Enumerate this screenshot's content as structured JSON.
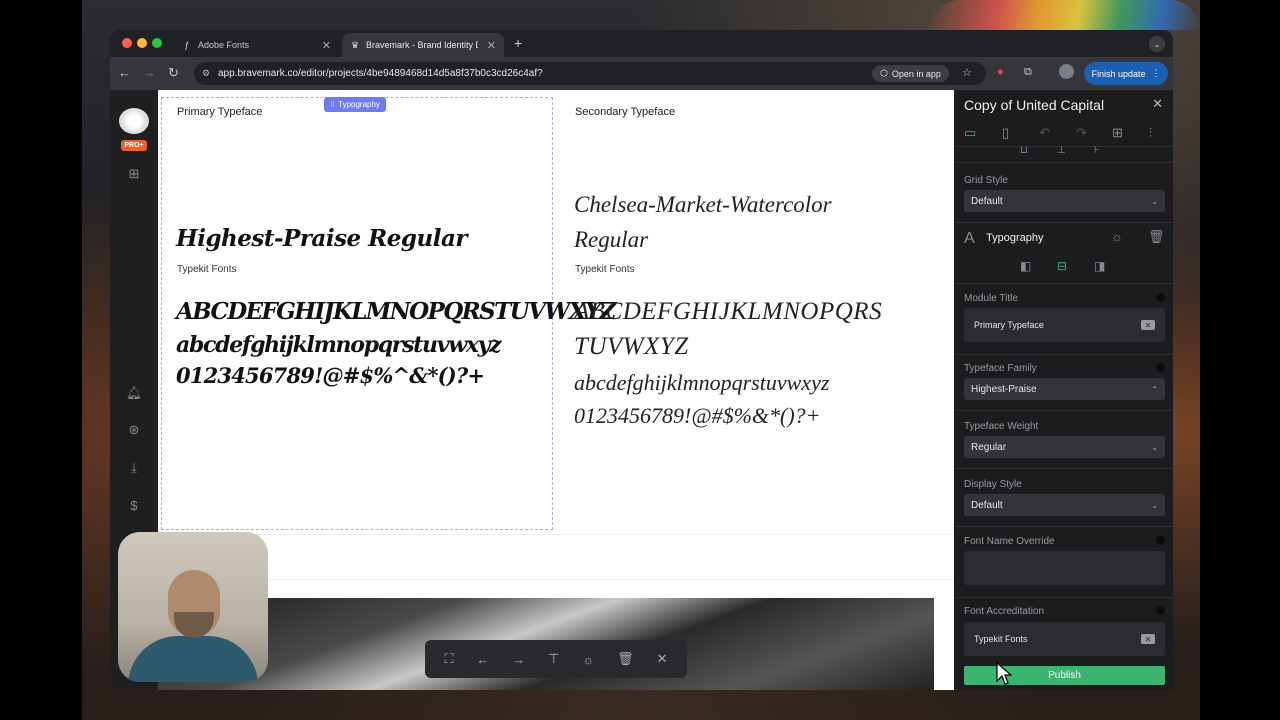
{
  "browser": {
    "tabs": [
      {
        "title": "Adobe Fonts",
        "icon": "adobe-fonts-icon"
      },
      {
        "title": "Bravemark - Brand Identity De",
        "icon": "bravemark-icon"
      }
    ],
    "url": "app.bravemark.co/editor/projects/4be9489468d14d5a8f37b0c3cd26c4af?",
    "open_in_app": "Open in app",
    "finish_update": "Finish update"
  },
  "app": {
    "logo_badge": "PRO+",
    "canvas": {
      "badge": "Typography",
      "primary": {
        "label": "Primary Typeface",
        "font_name": "Highest-Praise Regular",
        "source": "Typekit Fonts",
        "upper": "ABCDEFGHIJKLMNOPQRSTUVWXYZ",
        "lower": "abcdefghijklmnopqrstuvwxyz",
        "digits": "0123456789!@#$%^&*()?+"
      },
      "secondary": {
        "label": "Secondary Typeface",
        "font_name_line1": "Chelsea-Market-Watercolor",
        "font_name_line2": "Regular",
        "source": "Typekit Fonts",
        "upper_line1": "ABCDEFGHIJKLMNOPQRS",
        "upper_line2": "TUVWXYZ",
        "lower": "abcdefghijklmnopqrstuvwxyz",
        "digits": "0123456789!@#$%&*()?+"
      }
    },
    "panel": {
      "title": "Copy of United Capital",
      "grid_style_label": "Grid Style",
      "grid_style_value": "Default",
      "section_title": "Typography",
      "module_title_label": "Module Title",
      "module_title_value": "Primary Typeface",
      "typeface_family_label": "Typeface Family",
      "typeface_family_value": "Highest-Praise",
      "typeface_weight_label": "Typeface Weight",
      "typeface_weight_value": "Regular",
      "display_style_label": "Display Style",
      "display_style_value": "Default",
      "font_name_override_label": "Font Name Override",
      "font_name_override_value": "",
      "font_accreditation_label": "Font Accreditation",
      "font_accreditation_value": "Typekit Fonts",
      "publish": "Publish"
    }
  },
  "colors": {
    "accent_blue": "#1a5fb4",
    "badge_purple": "#6d7cf0",
    "publish_green": "#3cb371",
    "logo_orange": "#e8632a"
  }
}
